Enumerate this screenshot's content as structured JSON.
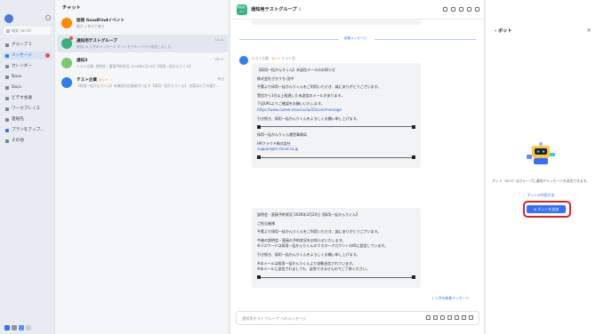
{
  "sidebar": {
    "search_placeholder": "検索 (⌘+K)",
    "items": [
      {
        "label": "グループ 1",
        "icon": "group-icon"
      },
      {
        "label": "メッセージ",
        "icon": "message-icon"
      },
      {
        "label": "カレンダー",
        "icon": "calendar-icon"
      },
      {
        "label": "Base",
        "icon": "base-icon"
      },
      {
        "label": "Docs",
        "icon": "docs-icon"
      },
      {
        "label": "ビデオ会議",
        "icon": "video-icon"
      },
      {
        "label": "ワークプレイス",
        "icon": "workplace-icon"
      },
      {
        "label": "連絡先",
        "icon": "contacts-icon"
      },
      {
        "label": "プランをアップ…",
        "icon": "upgrade-icon"
      },
      {
        "label": "その他",
        "icon": "more-icon"
      }
    ]
  },
  "chat_list": {
    "title": "チャット",
    "items": [
      {
        "name": "面接 GoodFindイベント",
        "snippet": "誰か 1 件の下書き",
        "time": "",
        "tag": ""
      },
      {
        "name": "通知用テストグループ",
        "snippet": "参加: ※ 3 件のメッセージ ボットをグループから削除しました。",
        "time": "16:21",
        "tag": ""
      },
      {
        "name": "通知3",
        "snippet": "テスト企業: 説明会・面接予約状況 2026年2月20日【採用一括かんりくん】",
        "time": "08:47",
        "tag": ""
      },
      {
        "name": "テスト企業",
        "snippet": "【採用一括かんりくん】未確認の応募者がいます【採用一括かんりくん】 内容は以下の通り…",
        "time": "昨日",
        "tag": "ボット"
      }
    ]
  },
  "chat": {
    "title": "通知用テストグループ",
    "member_count": "8",
    "header_avatar_text": "通知用テスト",
    "new_messages_divider": "新着メッセージ",
    "sender": "テスト企業",
    "sender_tag": "ボット",
    "sender_meta": "テスト用",
    "message1": [
      "【採用一括かんりくん】未返信メールのお知らせ",
      "株式会社さかうち 田中",
      "平素より採用一括かんりくんをご利用いただき、誠にありがとうございます。",
      "受信から1日以上経過した未返信のメールがあります。",
      "下記URLよりご確認をお願いいたします。",
      "https://www.career-cloud.asia/25/com/message",
      "引き続き、採用一括かんりくんをよろしくお願い申し上げます。",
      "採用一括かんりくん運営事務局",
      "HRクラウド株式会社",
      "support@hr-cloud.co.jp"
    ],
    "message2": [
      "説明会・面接予約状況 2026年2月20日【採用一括かんりくん】",
      "ご担当者様",
      "平素より採用一括かんりくんをご利用いただき、誠にありがとうございます。",
      "今後の説明会・面接の予約状況をお知らせいたします。",
      "※パスワードは採用一括かんりくんのマスターアカウントのIDに設定しています。",
      "引き続き、採用一括かんりくんをよろしくお願い申し上げます。",
      "※本メールは採用一括かんりくんより自動送信されています。",
      "※本メールに返信されましても、返答できませんのでご了承ください。"
    ],
    "new_count": "↓ 2 件の新着メッセージ",
    "input_placeholder": "通知用テストグループ へのメッセージ"
  },
  "bot_panel": {
    "title": "ボット",
    "description": "ボット（BOT）はグループに通知やメッセージを送信できます。",
    "link": "ボットの利用方法",
    "add_button": "ボットを追加"
  }
}
